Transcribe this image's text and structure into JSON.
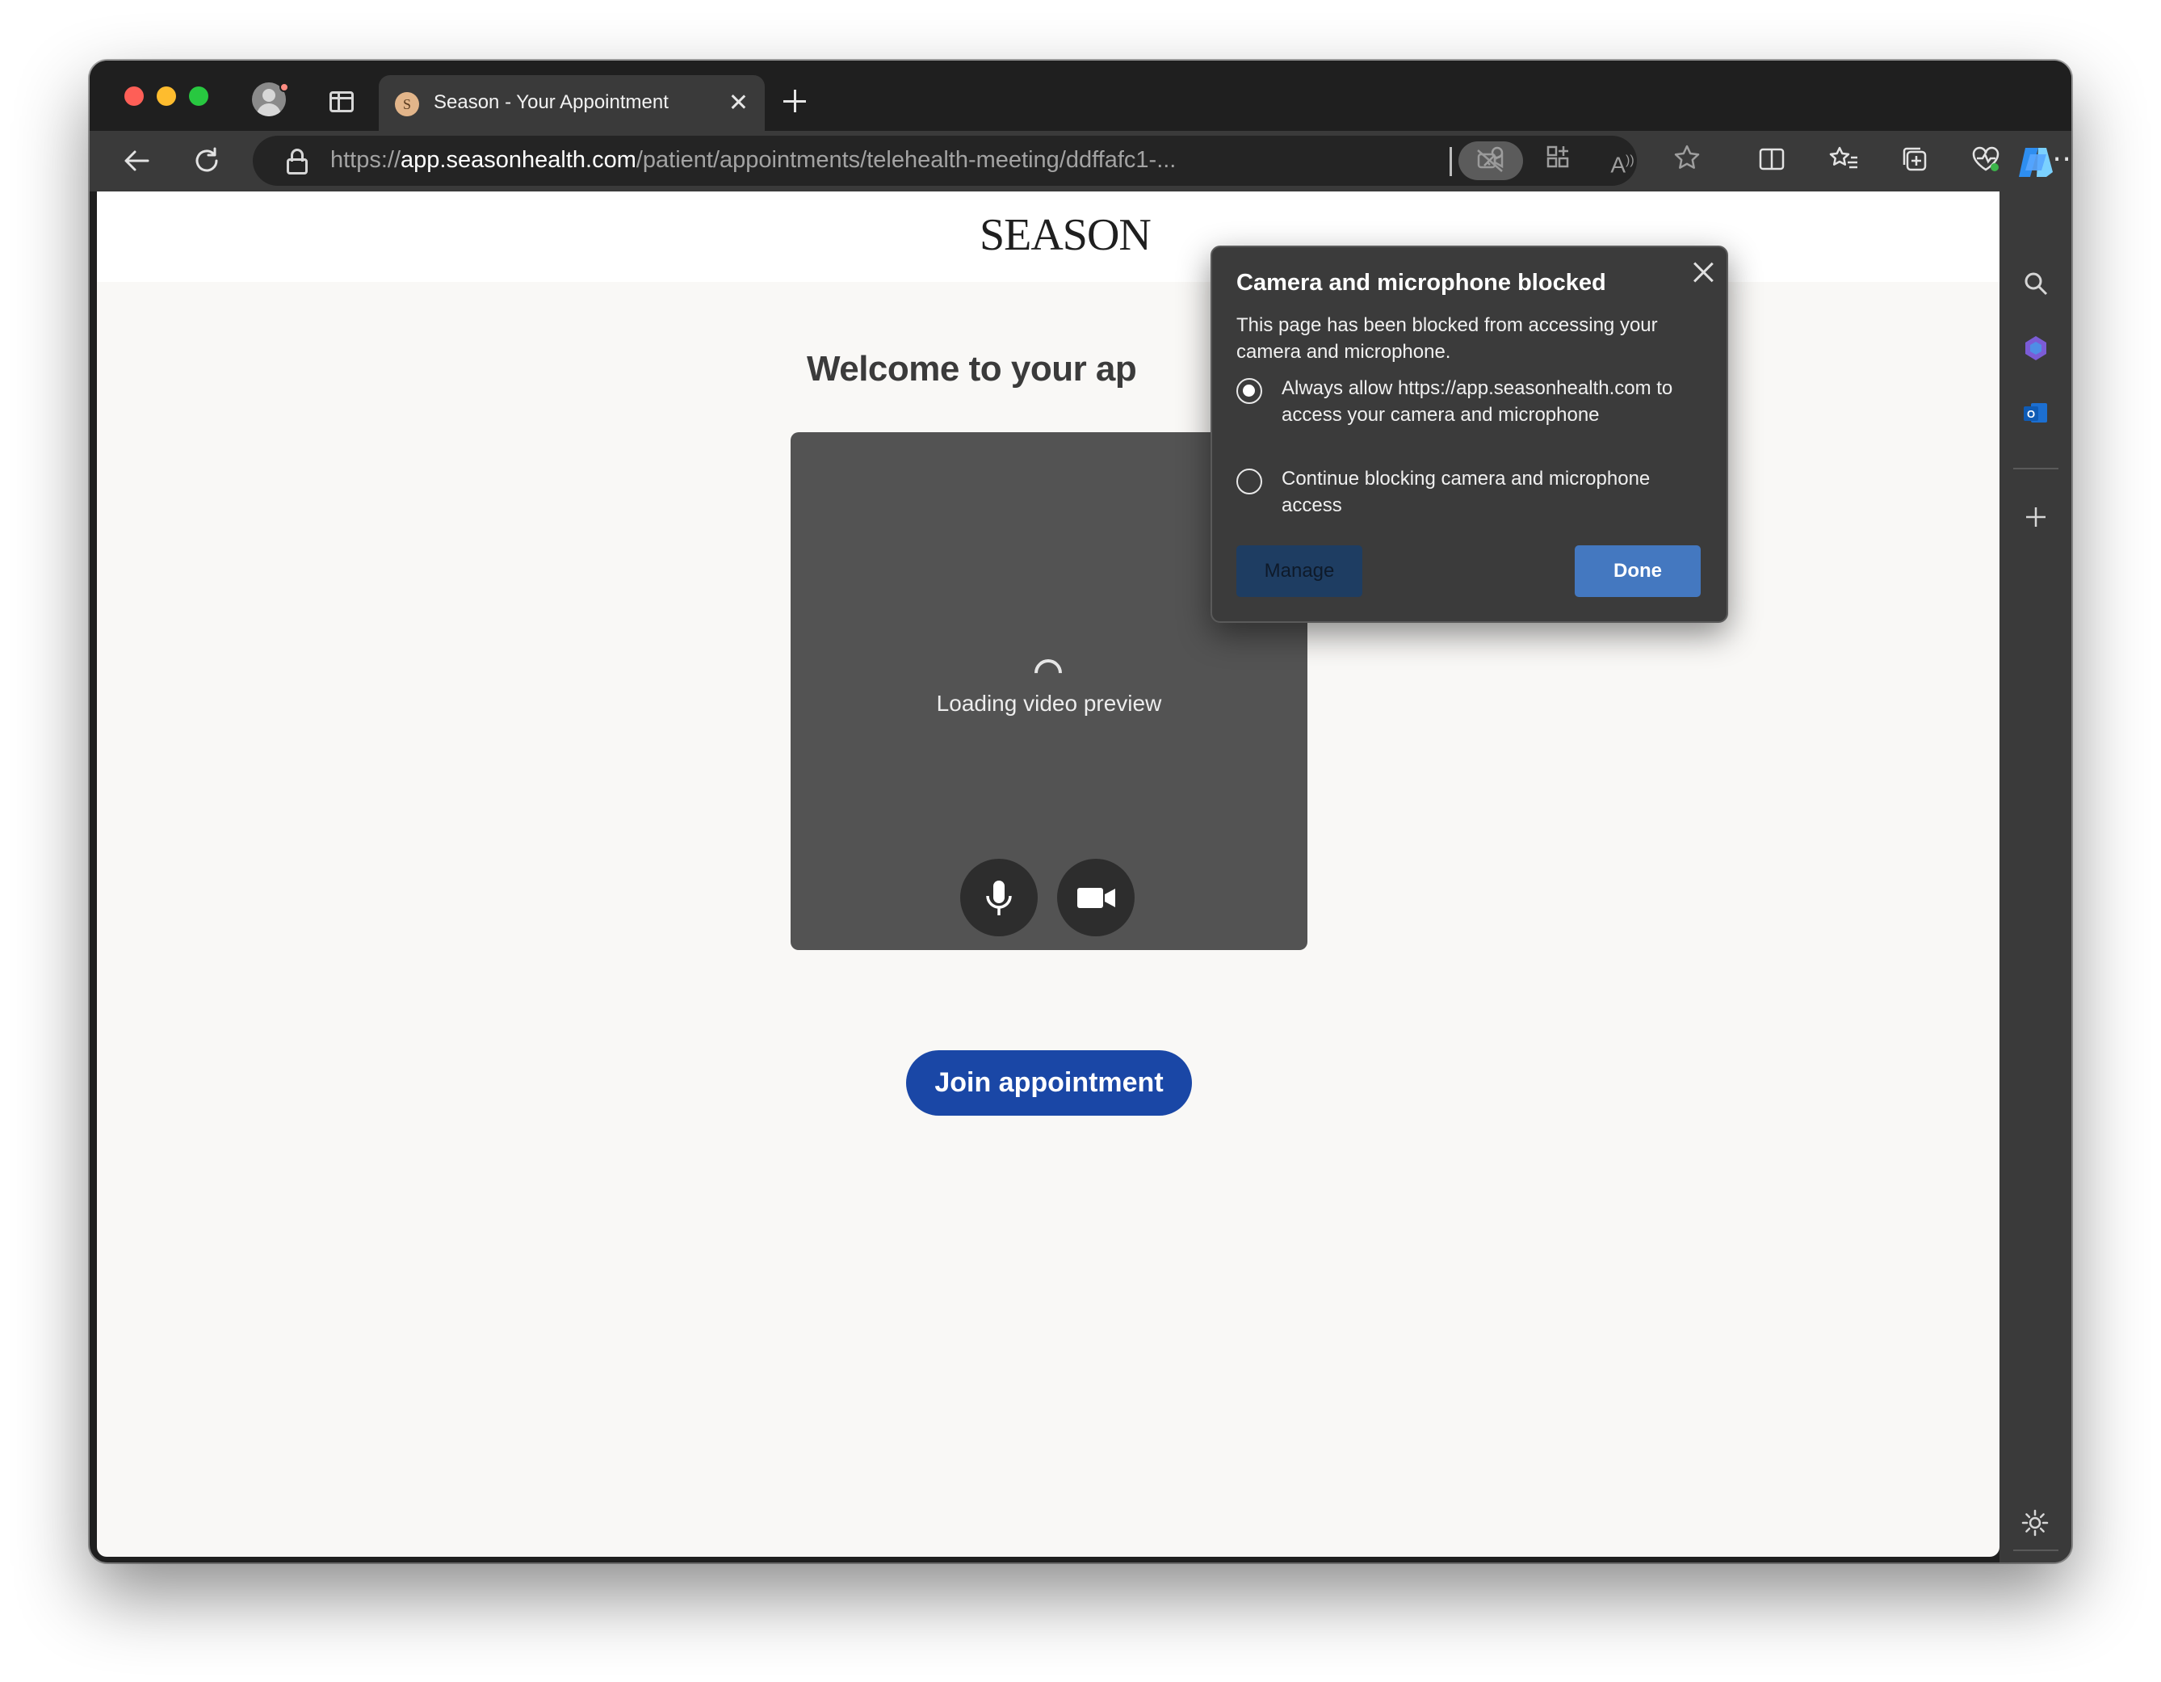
{
  "browser": {
    "tab": {
      "favicon_letter": "S",
      "title": "Season - Your Appointment"
    },
    "address": {
      "scheme": "https://",
      "host": "app.seasonhealth.com",
      "path": "/patient/appointments/telehealth-meeting/ddffafc1-..."
    },
    "icons": {
      "back": "back-arrow-icon",
      "refresh": "refresh-icon",
      "camera_blocked": "camera-blocked-icon",
      "password": "key-icon",
      "apps": "apps-icon",
      "read_aloud": "read-aloud-icon",
      "favorite": "star-icon",
      "split_screen": "split-screen-icon",
      "favorites": "favorites-icon",
      "collections": "collections-icon",
      "browser_essentials": "heart-pulse-icon",
      "more": "ellipsis-icon",
      "copilot": "copilot-icon"
    }
  },
  "sidebar": {
    "icons": [
      "search-icon",
      "copilot-sidebar-icon",
      "outlook-icon",
      "plus-icon",
      "gear-icon"
    ]
  },
  "page": {
    "logo": "SEASON",
    "welcome": "Welcome to your ap",
    "preview": {
      "loading_text": "Loading video preview"
    },
    "join_label": "Join appointment"
  },
  "popup": {
    "title": "Camera and microphone blocked",
    "description": "This page has been blocked from accessing your camera and microphone.",
    "options": [
      {
        "label": "Always allow https://app.seasonhealth.com to access your camera and microphone",
        "selected": true
      },
      {
        "label": "Continue blocking camera and microphone access",
        "selected": false
      }
    ],
    "manage_label": "Manage",
    "done_label": "Done"
  },
  "colors": {
    "accent_join": "#1a47a6",
    "done_button": "#4478c0",
    "manage_button": "#1e3d62",
    "page_background": "#f9f8f6"
  }
}
